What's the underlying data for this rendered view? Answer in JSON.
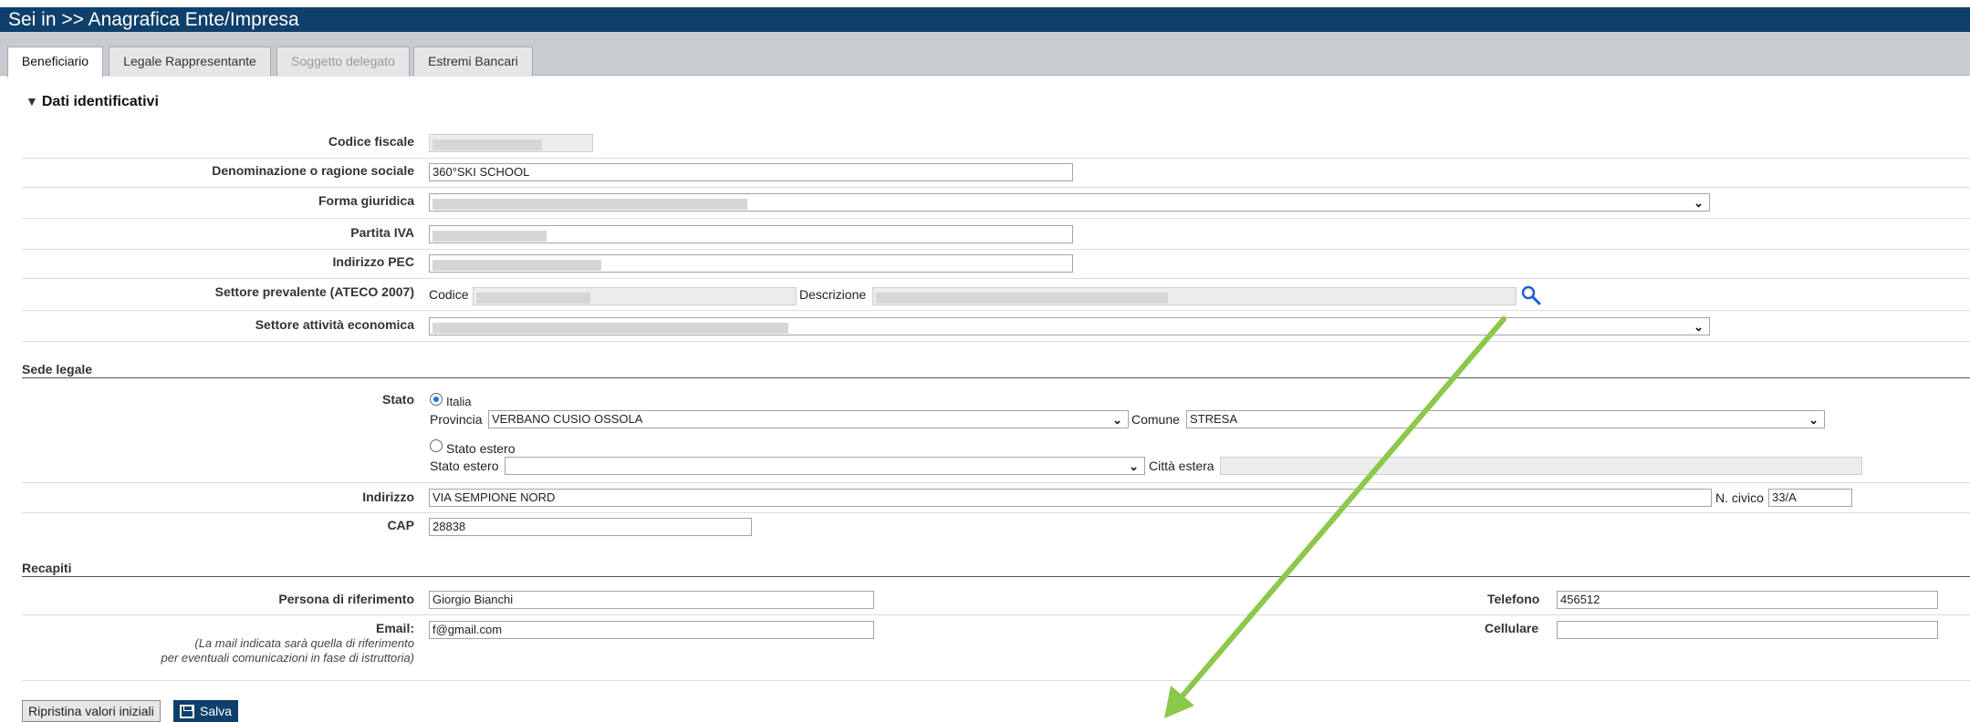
{
  "header": {
    "title": "Sei in >> Anagrafica Ente/Impresa"
  },
  "tabs": [
    {
      "label": "Beneficiario",
      "state": "active"
    },
    {
      "label": "Legale Rappresentante",
      "state": "normal"
    },
    {
      "label": "Soggetto delegato",
      "state": "disabled"
    },
    {
      "label": "Estremi Bancari",
      "state": "normal"
    }
  ],
  "identificativi": {
    "section_title": "Dati identificativi",
    "codice_fiscale_label": "Codice fiscale",
    "denominazione_label": "Denominazione o ragione sociale",
    "denominazione_value": "360°SKI SCHOOL",
    "forma_giuridica_label": "Forma giuridica",
    "partita_iva_label": "Partita IVA",
    "pec_label": "Indirizzo PEC",
    "ateco_label": "Settore prevalente (ATECO 2007)",
    "ateco_codice_label": "Codice",
    "ateco_descrizione_label": "Descrizione",
    "settore_label": "Settore attività economica"
  },
  "sede_legale": {
    "heading": "Sede legale",
    "stato_label": "Stato",
    "italia_label": "Italia",
    "provincia_label": "Provincia",
    "provincia_value": "VERBANO CUSIO OSSOLA",
    "comune_label": "Comune",
    "comune_value": "STRESA",
    "stato_estero_radio_label": "Stato estero",
    "stato_estero_label": "Stato estero",
    "citta_estera_label": "Città estera",
    "indirizzo_label": "Indirizzo",
    "indirizzo_value": "VIA SEMPIONE NORD",
    "civico_label": "N. civico",
    "civico_value": "33/A",
    "cap_label": "CAP",
    "cap_value": "28838"
  },
  "recapiti": {
    "heading": "Recapiti",
    "persona_label": "Persona di riferimento",
    "persona_value": "Giorgio Bianchi",
    "telefono_label": "Telefono",
    "telefono_value": "456512",
    "email_label": "Email:",
    "email_note_1": "(La mail indicata sarà quella di riferimento",
    "email_note_2": "per eventuali comunicazioni in fase di istruttoria)",
    "email_value": "f@gmail.com",
    "cellulare_label": "Cellulare",
    "cellulare_value": ""
  },
  "actions": {
    "reset_label": "Ripristina valori iniziali",
    "save_label": "Salva"
  },
  "colors": {
    "header_bg": "#0f3f6b",
    "annotation_arrow": "#8cc84b",
    "search_icon": "#1a5fd0"
  }
}
